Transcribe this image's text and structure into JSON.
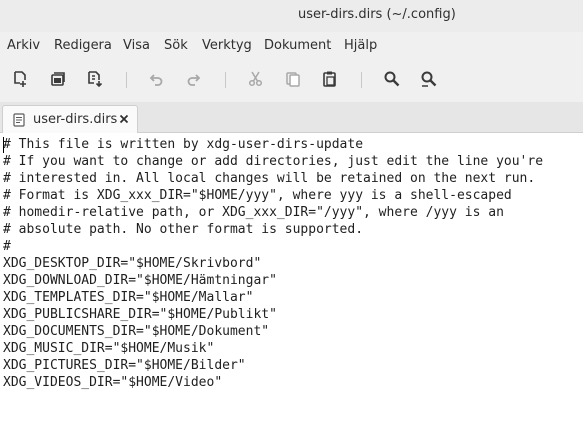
{
  "window": {
    "title": "user-dirs.dirs (~/.config)"
  },
  "menubar": {
    "items": [
      "Arkiv",
      "Redigera",
      "Visa",
      "Sök",
      "Verktyg",
      "Dokument",
      "Hjälp"
    ]
  },
  "toolbar": {
    "buttons": [
      {
        "icon": "new-document-icon",
        "enabled": true
      },
      {
        "icon": "open-document-icon",
        "enabled": true
      },
      {
        "icon": "save-document-icon",
        "enabled": true
      },
      {
        "icon": "undo-icon",
        "enabled": false
      },
      {
        "icon": "redo-icon",
        "enabled": false
      },
      {
        "icon": "cut-icon",
        "enabled": false
      },
      {
        "icon": "copy-icon",
        "enabled": false
      },
      {
        "icon": "paste-icon",
        "enabled": true
      },
      {
        "icon": "search-icon",
        "enabled": true
      },
      {
        "icon": "search-replace-icon",
        "enabled": true
      }
    ]
  },
  "tabs": [
    {
      "label": "user-dirs.dirs",
      "active": true
    }
  ],
  "editor": {
    "lines": [
      "# This file is written by xdg-user-dirs-update",
      "# If you want to change or add directories, just edit the line you're",
      "# interested in. All local changes will be retained on the next run.",
      "# Format is XDG_xxx_DIR=\"$HOME/yyy\", where yyy is a shell-escaped",
      "# homedir-relative path, or XDG_xxx_DIR=\"/yyy\", where /yyy is an",
      "# absolute path. No other format is supported.",
      "#",
      "XDG_DESKTOP_DIR=\"$HOME/Skrivbord\"",
      "XDG_DOWNLOAD_DIR=\"$HOME/Hämtningar\"",
      "XDG_TEMPLATES_DIR=\"$HOME/Mallar\"",
      "XDG_PUBLICSHARE_DIR=\"$HOME/Publikt\"",
      "XDG_DOCUMENTS_DIR=\"$HOME/Dokument\"",
      "XDG_MUSIC_DIR=\"$HOME/Musik\"",
      "XDG_PICTURES_DIR=\"$HOME/Bilder\"",
      "XDG_VIDEOS_DIR=\"$HOME/Video\""
    ]
  },
  "colors": {
    "text": "#1f1f1f",
    "icon": "#3a3a3a",
    "icon_disabled": "#a8a8a8"
  }
}
